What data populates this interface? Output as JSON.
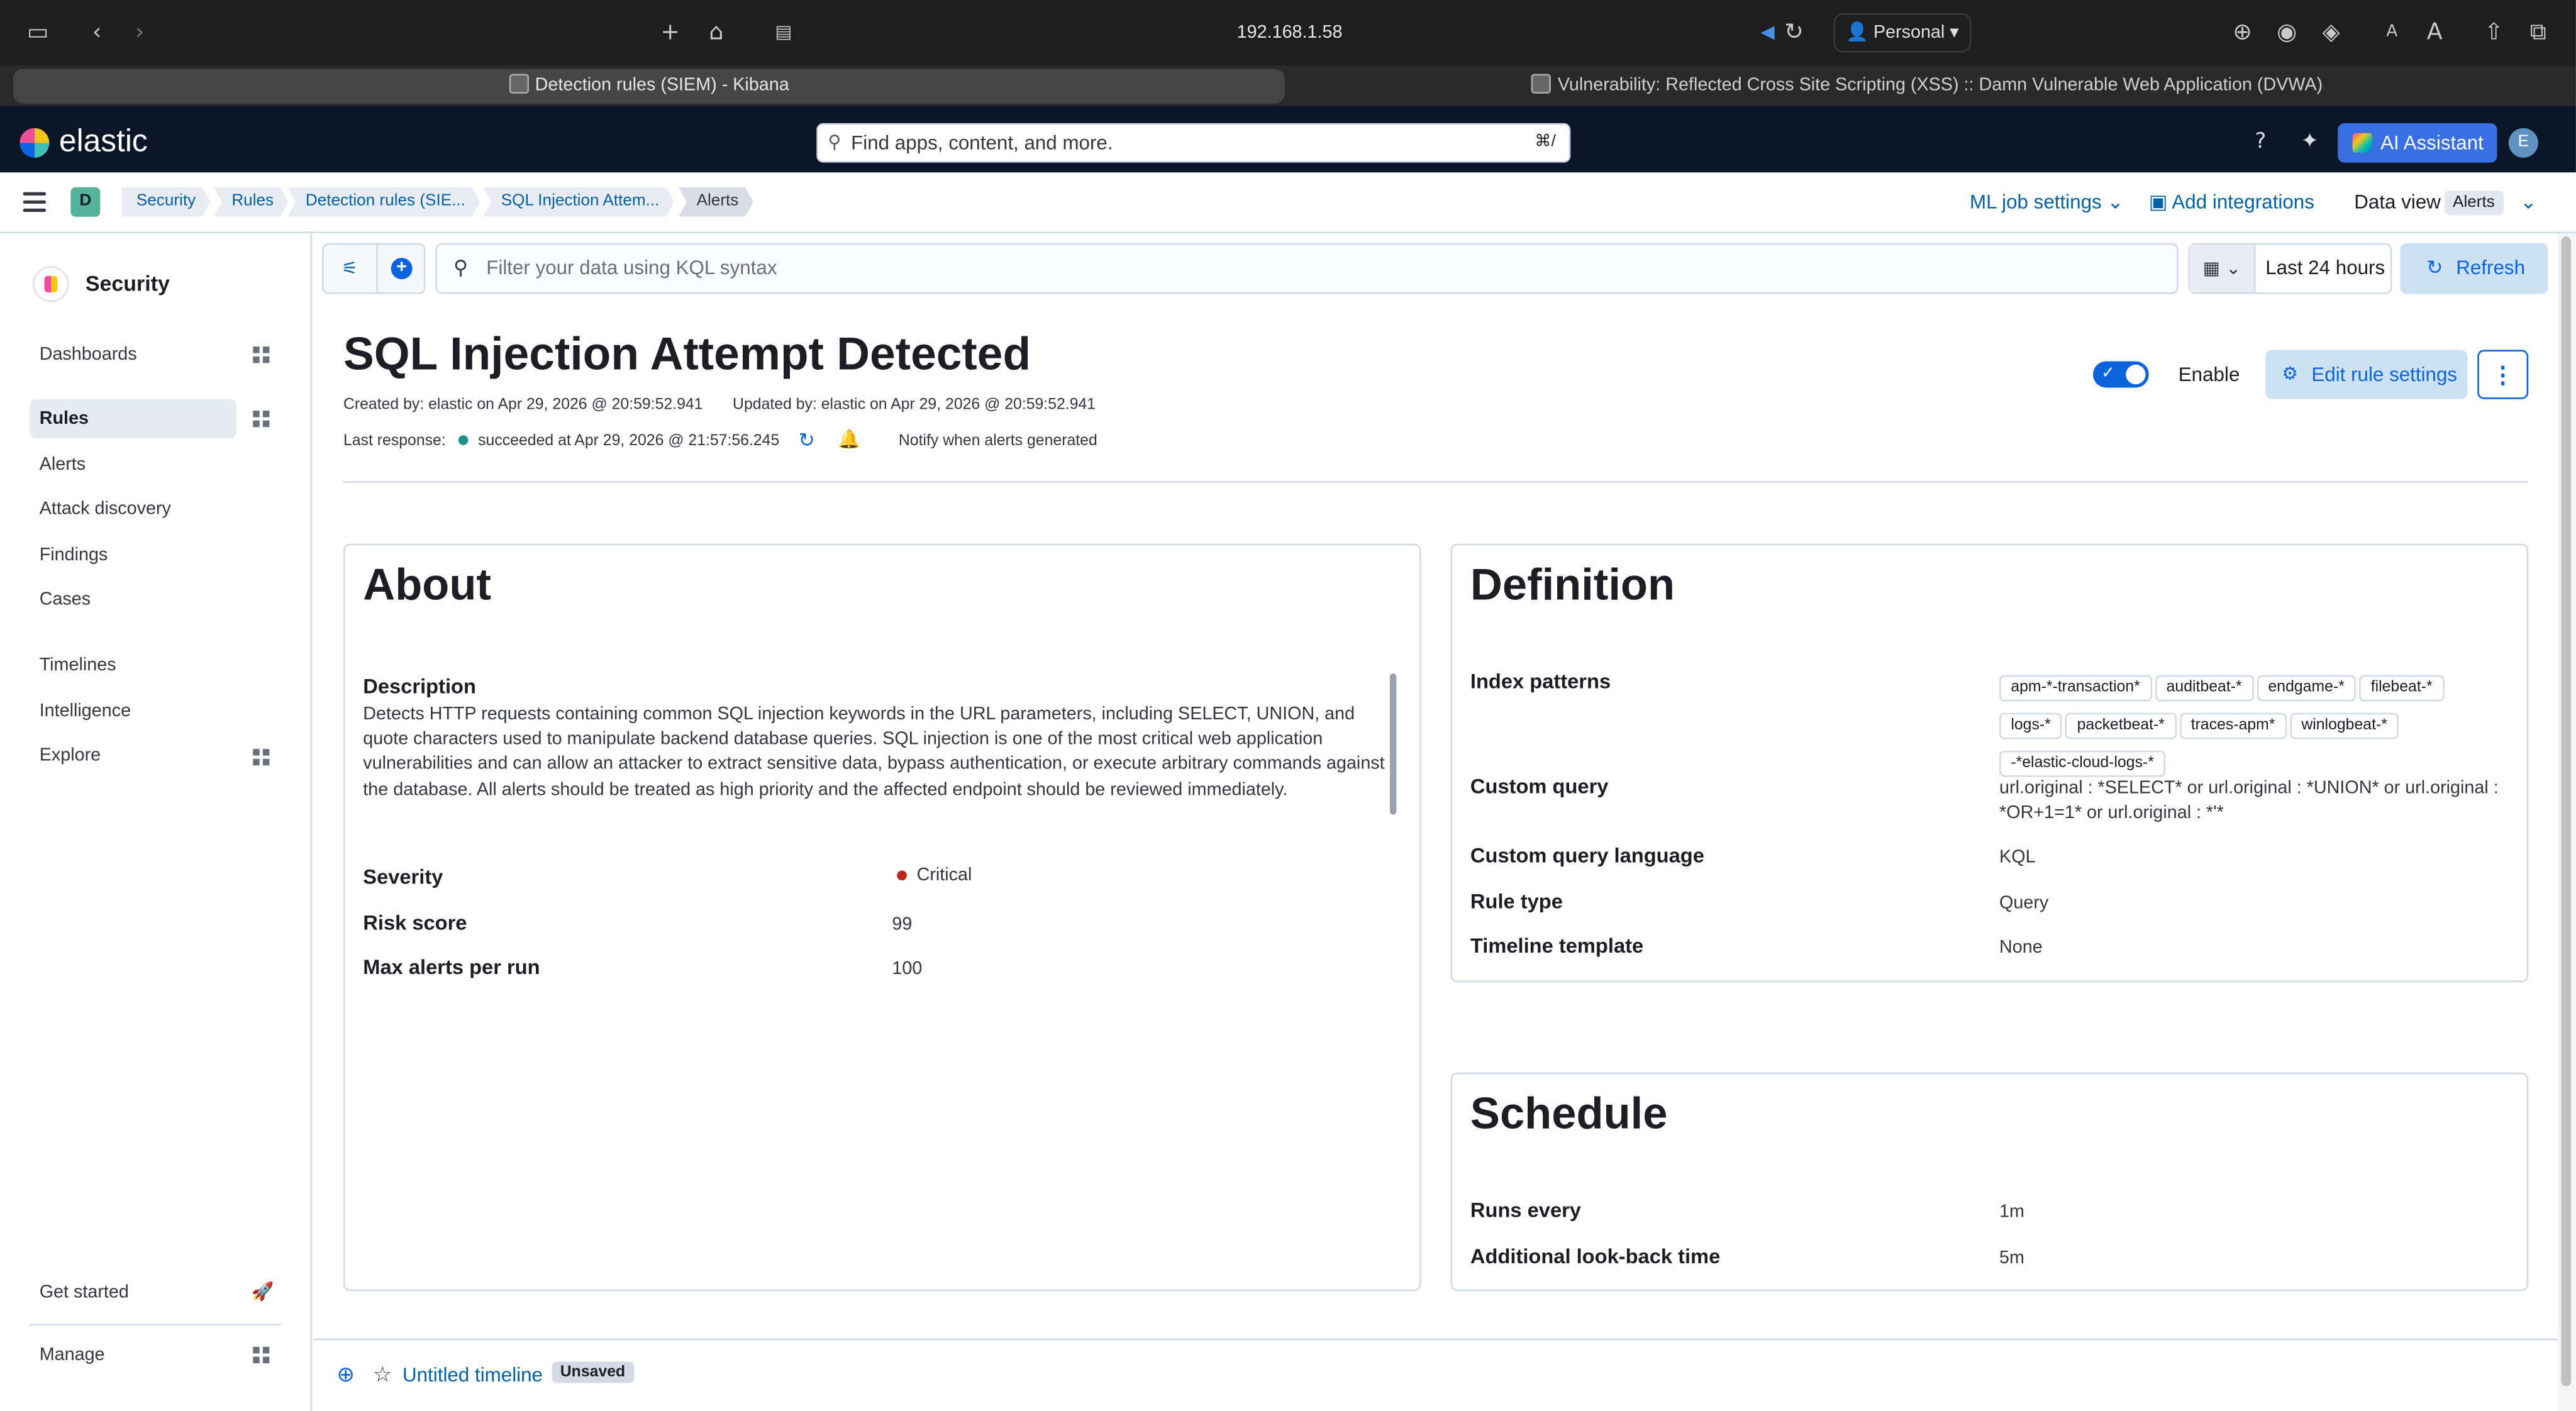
{
  "browser": {
    "url": "192.168.1.58",
    "profile": "Personal",
    "tabs": [
      {
        "title": "Detection rules (SIEM) - Kibana",
        "active": true
      },
      {
        "title": "Vulnerability: Reflected Cross Site Scripting (XSS) :: Damn Vulnerable Web Application (DVWA)",
        "active": false
      }
    ]
  },
  "header": {
    "logo_text": "elastic",
    "search_placeholder": "Find apps, content, and more.",
    "search_shortcut": "⌘/",
    "ai_assistant_label": "AI Assistant",
    "avatar_initial": "E"
  },
  "breadcrumbs": {
    "space_initial": "D",
    "items": [
      "Security",
      "Rules",
      "Detection rules (SIE...",
      "SQL Injection Attem...",
      "Alerts"
    ],
    "ml_job_settings": "ML job settings",
    "add_integrations": "Add integrations",
    "data_view_label": "Data view",
    "data_view_value": "Alerts"
  },
  "sidebar": {
    "title": "Security",
    "items": [
      {
        "label": "Dashboards"
      },
      {
        "label": "Rules"
      },
      {
        "label": "Alerts"
      },
      {
        "label": "Attack discovery"
      },
      {
        "label": "Findings"
      },
      {
        "label": "Cases"
      },
      {
        "label": "Timelines"
      },
      {
        "label": "Intelligence"
      },
      {
        "label": "Explore"
      }
    ],
    "get_started": "Get started",
    "manage": "Manage"
  },
  "querybar": {
    "placeholder": "Filter your data using KQL syntax",
    "time_range": "Last 24 hours",
    "refresh_label": "Refresh"
  },
  "rule": {
    "title": "SQL Injection Attempt Detected",
    "created": "Created by: elastic on Apr 29, 2026 @ 20:59:52.941",
    "updated": "Updated by: elastic on Apr 29, 2026 @ 20:59:52.941",
    "last_response_label": "Last response:",
    "last_response_status": "succeeded at Apr 29, 2026 @ 21:57:56.245",
    "notify_text": "Notify when alerts generated",
    "enable_label": "Enable",
    "enabled": true,
    "edit_button": "Edit rule settings"
  },
  "about": {
    "title": "About",
    "description_label": "Description",
    "description": "Detects HTTP requests containing common SQL injection keywords in the URL parameters, including SELECT, UNION, and quote characters used to manipulate backend database queries. SQL injection is one of the most critical web application vulnerabilities and can allow an attacker to extract sensitive data, bypass authentication, or execute arbitrary commands against the database. All alerts should be treated as high priority and the affected endpoint should be reviewed immediately.",
    "severity_label": "Severity",
    "severity_value": "Critical",
    "severity_color": "#bd271e",
    "risk_score_label": "Risk score",
    "risk_score_value": "99",
    "max_alerts_label": "Max alerts per run",
    "max_alerts_value": "100"
  },
  "definition": {
    "title": "Definition",
    "index_patterns_label": "Index patterns",
    "index_patterns": [
      "apm-*-transaction*",
      "auditbeat-*",
      "endgame-*",
      "filebeat-*",
      "logs-*",
      "packetbeat-*",
      "traces-apm*",
      "winlogbeat-*",
      "-*elastic-cloud-logs-*"
    ],
    "custom_query_label": "Custom query",
    "custom_query": "url.original : *SELECT* or url.original : *UNION* or url.original : *OR+1=1* or url.original : *'*",
    "query_language_label": "Custom query language",
    "query_language": "KQL",
    "rule_type_label": "Rule type",
    "rule_type": "Query",
    "timeline_template_label": "Timeline template",
    "timeline_template": "None"
  },
  "schedule": {
    "title": "Schedule",
    "runs_every_label": "Runs every",
    "runs_every": "1m",
    "lookback_label": "Additional look-back time",
    "lookback": "5m"
  },
  "timeline": {
    "name": "Untitled timeline",
    "badge": "Unsaved"
  },
  "colors": {
    "accent": "#0b64dd",
    "header_bg": "#0b1628",
    "success": "#209280"
  }
}
